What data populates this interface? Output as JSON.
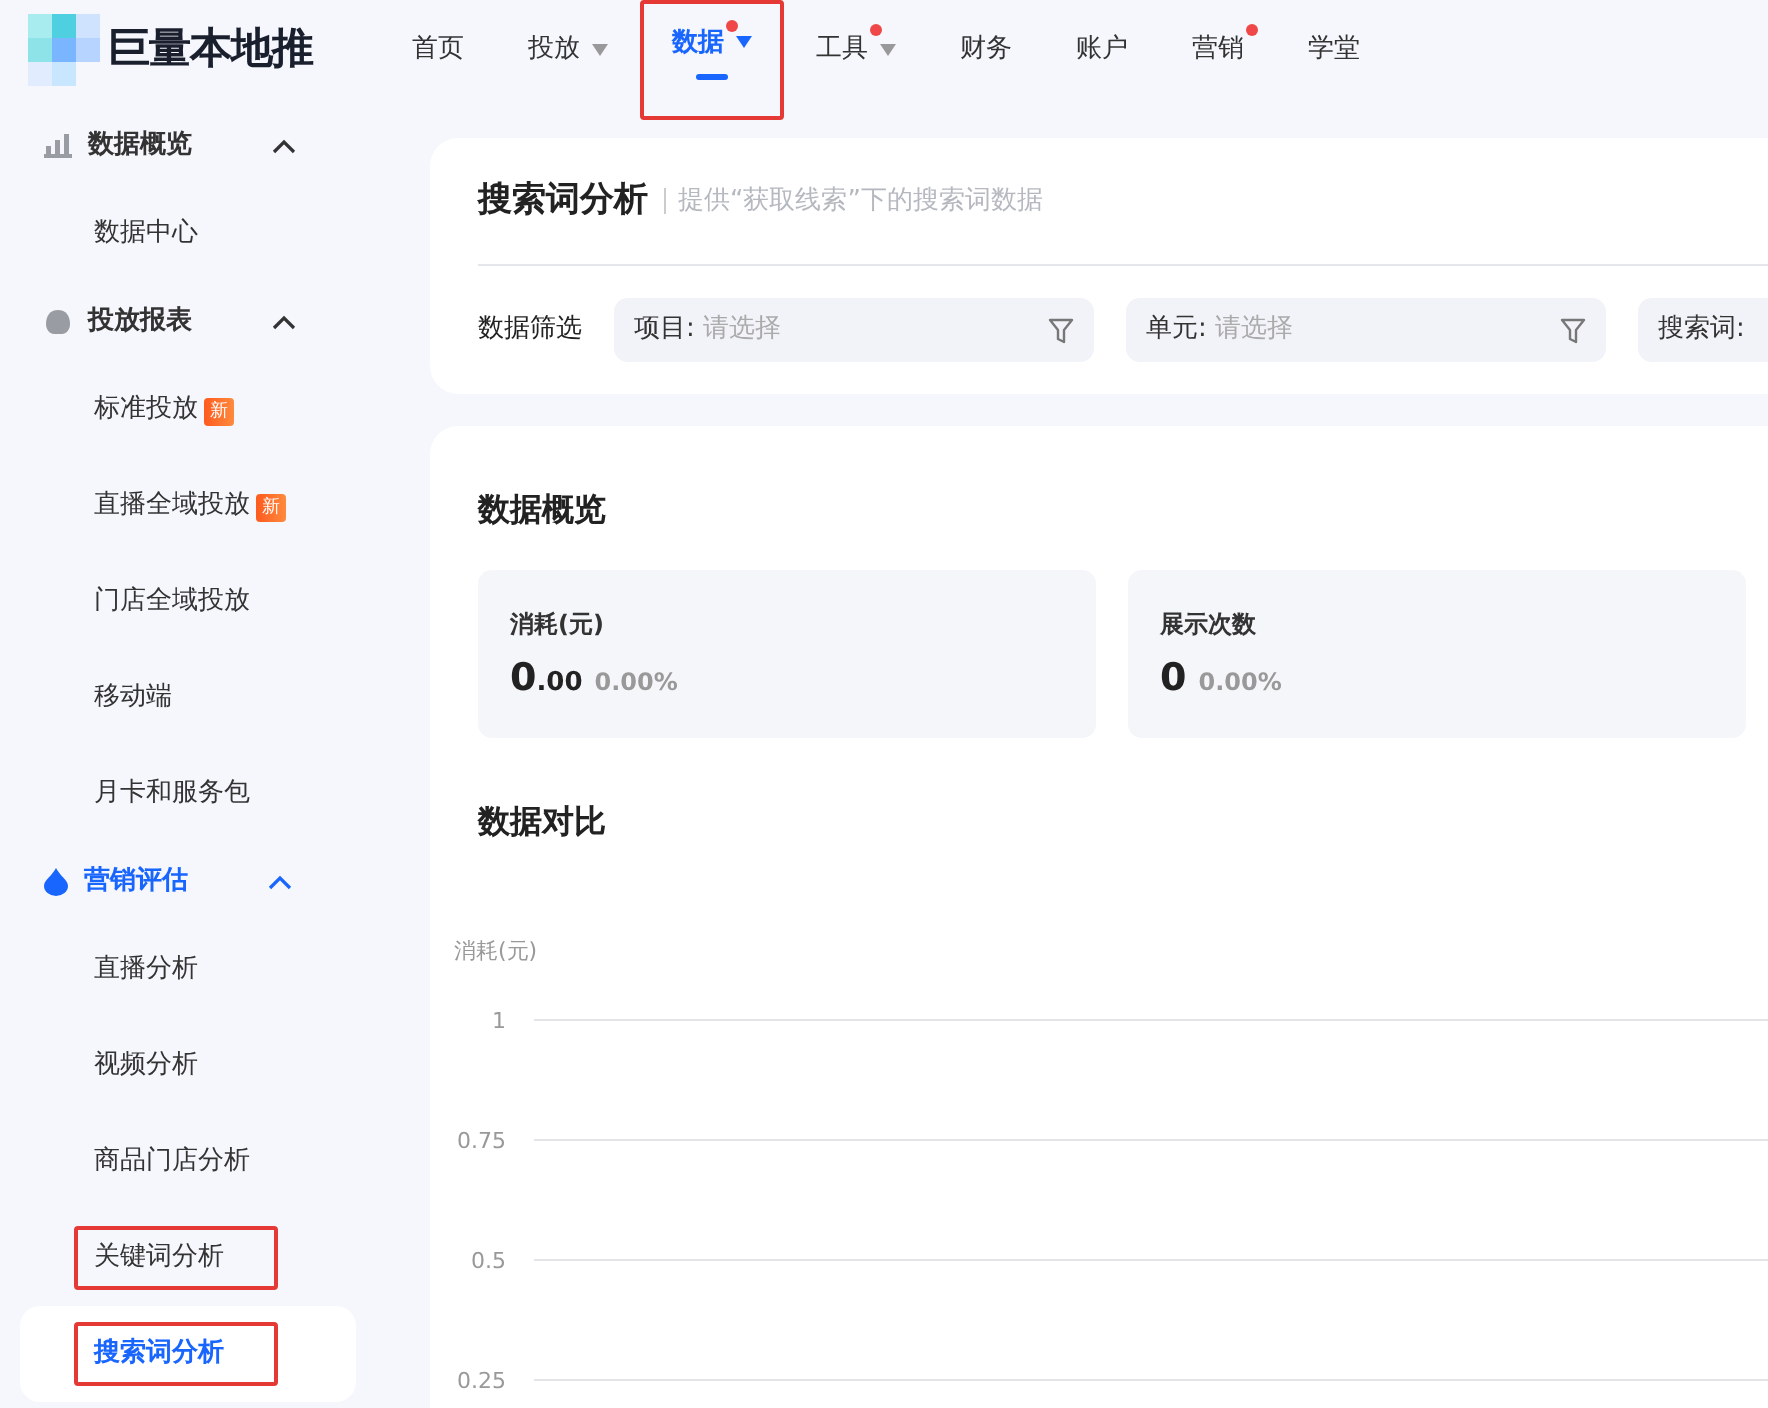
{
  "logo": {
    "text": "巨量本地推"
  },
  "nav": [
    {
      "label": "首页",
      "selected": false,
      "dropdown": false,
      "dot": false,
      "highlighted": false
    },
    {
      "label": "投放",
      "selected": false,
      "dropdown": true,
      "dot": false,
      "highlighted": false
    },
    {
      "label": "数据",
      "selected": true,
      "dropdown": true,
      "dot": true,
      "highlighted": true
    },
    {
      "label": "工具",
      "selected": false,
      "dropdown": true,
      "dot": true,
      "highlighted": false
    },
    {
      "label": "财务",
      "selected": false,
      "dropdown": false,
      "dot": false,
      "highlighted": false
    },
    {
      "label": "账户",
      "selected": false,
      "dropdown": false,
      "dot": false,
      "highlighted": false
    },
    {
      "label": "营销",
      "selected": false,
      "dropdown": false,
      "dot": true,
      "highlighted": false
    },
    {
      "label": "学堂",
      "selected": false,
      "dropdown": false,
      "dot": false,
      "highlighted": false
    }
  ],
  "sidebar": {
    "groups": [
      {
        "title": "数据概览",
        "active": false,
        "expanded": true,
        "items": [
          {
            "label": "数据中心",
            "selected": false,
            "highlighted": false
          }
        ]
      },
      {
        "title": "投放报表",
        "active": false,
        "expanded": true,
        "items": [
          {
            "label": "标准投放",
            "badge": "新",
            "selected": false,
            "highlighted": false
          },
          {
            "label": "直播全域投放",
            "badge": "新",
            "selected": false,
            "highlighted": false
          },
          {
            "label": "门店全域投放",
            "selected": false,
            "highlighted": false
          },
          {
            "label": "移动端",
            "selected": false,
            "highlighted": false
          },
          {
            "label": "月卡和服务包",
            "selected": false,
            "highlighted": false
          }
        ]
      },
      {
        "title": "营销评估",
        "active": true,
        "expanded": true,
        "items": [
          {
            "label": "直播分析",
            "selected": false,
            "highlighted": false
          },
          {
            "label": "视频分析",
            "selected": false,
            "highlighted": false
          },
          {
            "label": "商品门店分析",
            "selected": false,
            "highlighted": false
          },
          {
            "label": "关键词分析",
            "selected": false,
            "highlighted": true
          },
          {
            "label": "搜索词分析",
            "selected": true,
            "highlighted": true
          }
        ]
      }
    ]
  },
  "header": {
    "title": "搜索词分析",
    "subtitle": "提供“获取线索”下的搜索词数据",
    "filter_label": "数据筛选",
    "filters": [
      {
        "label": "项目:",
        "placeholder": "请选择"
      },
      {
        "label": "单元:",
        "placeholder": "请选择"
      },
      {
        "label": "搜索词:"
      }
    ]
  },
  "overview": {
    "title": "数据概览",
    "metrics": [
      {
        "label": "消耗(元)",
        "value": "0",
        "decimals": ".00",
        "change": "0.00%"
      },
      {
        "label": "展示次数",
        "value": "0",
        "change": "0.00%"
      }
    ]
  },
  "comparison": {
    "title": "数据对比",
    "axis_title": "消耗(元)",
    "axis_labels": [
      "1",
      "0.75",
      "0.5",
      "0.25"
    ]
  }
}
